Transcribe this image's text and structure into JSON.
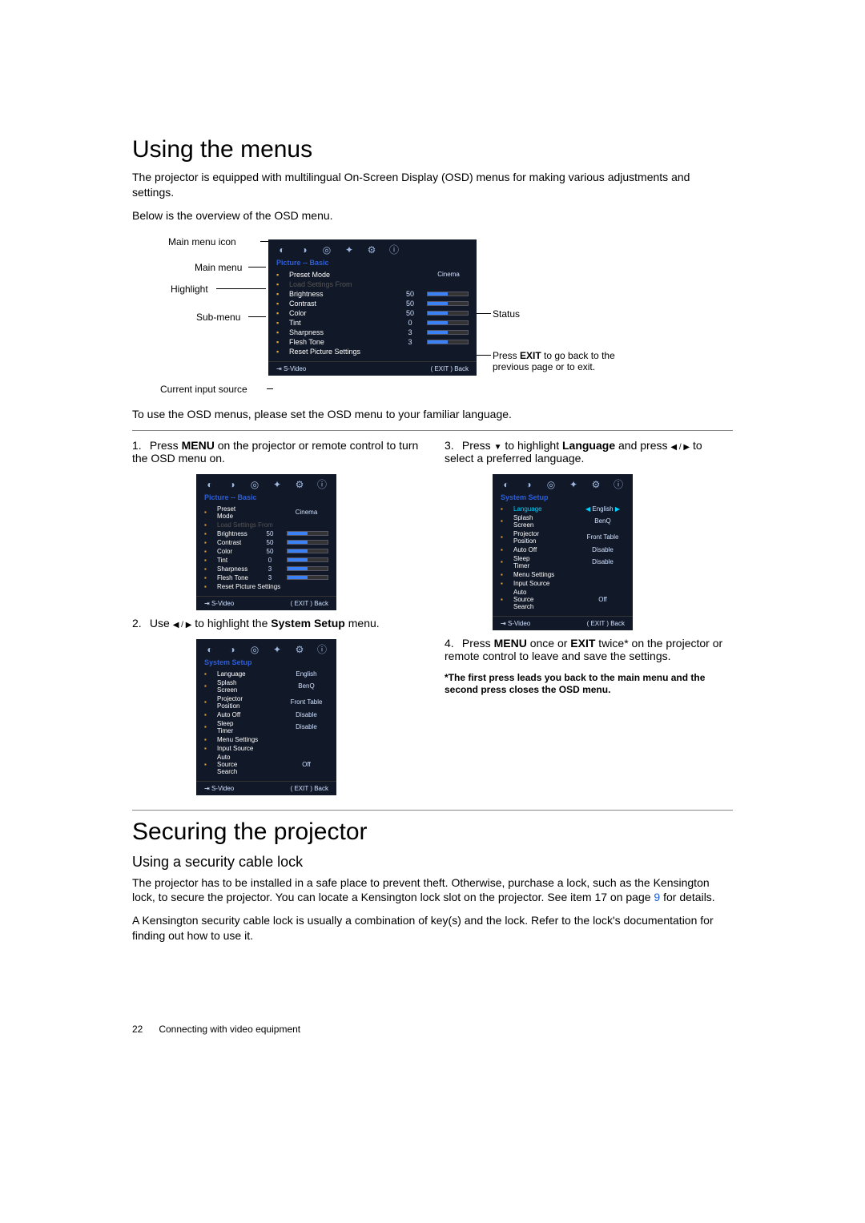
{
  "heading1": "Using the menus",
  "p1": "The projector is equipped with multilingual On-Screen Display (OSD) menus for making various adjustments and settings.",
  "p2": "Below is the overview of the OSD menu.",
  "diagram": {
    "labels": {
      "main_menu_icon": "Main menu icon",
      "main_menu": "Main menu",
      "highlight": "Highlight",
      "sub_menu": "Sub-menu",
      "current_input_source": "Current input source",
      "status": "Status",
      "exit_note_pre": "Press ",
      "exit_note_bold": "EXIT",
      "exit_note_post": " to go back to the previous page or to exit."
    }
  },
  "osd_big": {
    "title": "Picture -- Basic",
    "rows": [
      {
        "label": "Preset Mode",
        "rval": "Cinema"
      },
      {
        "label": "Load Settings From",
        "disabled": true
      },
      {
        "label": "Brightness",
        "val": "50",
        "slider": true
      },
      {
        "label": "Contrast",
        "val": "50",
        "slider": true
      },
      {
        "label": "Color",
        "val": "50",
        "slider": true
      },
      {
        "label": "Tint",
        "val": "0",
        "slider": true
      },
      {
        "label": "Sharpness",
        "val": "3",
        "slider": true
      },
      {
        "label": "Flesh Tone",
        "val": "3",
        "slider": true
      },
      {
        "label": "Reset Picture Settings"
      }
    ],
    "source": "S-Video",
    "exit": "EXIT",
    "back": "Back"
  },
  "osd_setup": {
    "title": "System Setup",
    "rows": [
      {
        "label": "Language",
        "rval": "English"
      },
      {
        "label": "Splash Screen",
        "rval": "BenQ"
      },
      {
        "label": "Projector Position",
        "rval": "Front Table"
      },
      {
        "label": "Auto Off",
        "rval": "Disable"
      },
      {
        "label": "Sleep Timer",
        "rval": "Disable"
      },
      {
        "label": "Menu Settings"
      },
      {
        "label": "Input Source"
      },
      {
        "label": "Auto Source Search",
        "rval": "Off"
      }
    ],
    "source": "S-Video",
    "exit": "EXIT",
    "back": "Back"
  },
  "p3": "To use the OSD menus, please set the OSD menu to your familiar language.",
  "steps": {
    "s1_pre": "Press ",
    "s1_b": "MENU",
    "s1_post": " on the projector or remote control to turn the OSD menu on.",
    "s2_pre": "Use ",
    "s2_arrows": "◀ / ▶",
    "s2_mid": " to highlight the ",
    "s2_b": "System Setup",
    "s2_post": " menu.",
    "s3_pre": "Press ",
    "s3_dn": "▼",
    "s3_mid": " to highlight ",
    "s3_b": "Language",
    "s3_mid2": " and press ",
    "s3_arrows": "◀ / ▶",
    "s3_post": " to select a preferred language.",
    "s4_pre": "Press ",
    "s4_b1": "MENU",
    "s4_mid": " once or ",
    "s4_b2": "EXIT",
    "s4_post": " twice* on the projector or remote control to leave and save the settings.",
    "note": "*The first press leads you back to the main menu and the second press closes the OSD menu."
  },
  "heading2": "Securing the projector",
  "sub2": "Using a security cable lock",
  "p4_pre": "The projector has to be installed in a safe place to prevent theft. Otherwise, purchase a lock, such as the Kensington lock, to secure the projector. You can locate a Kensington lock slot on the projector. See item 17 on page ",
  "p4_link": "9",
  "p4_post": " for details.",
  "p5": "A Kensington security cable lock is usually a combination of key(s) and the lock. Refer to the lock's documentation for finding out how to use it.",
  "footer": {
    "page": "22",
    "section": "Connecting with video equipment"
  }
}
